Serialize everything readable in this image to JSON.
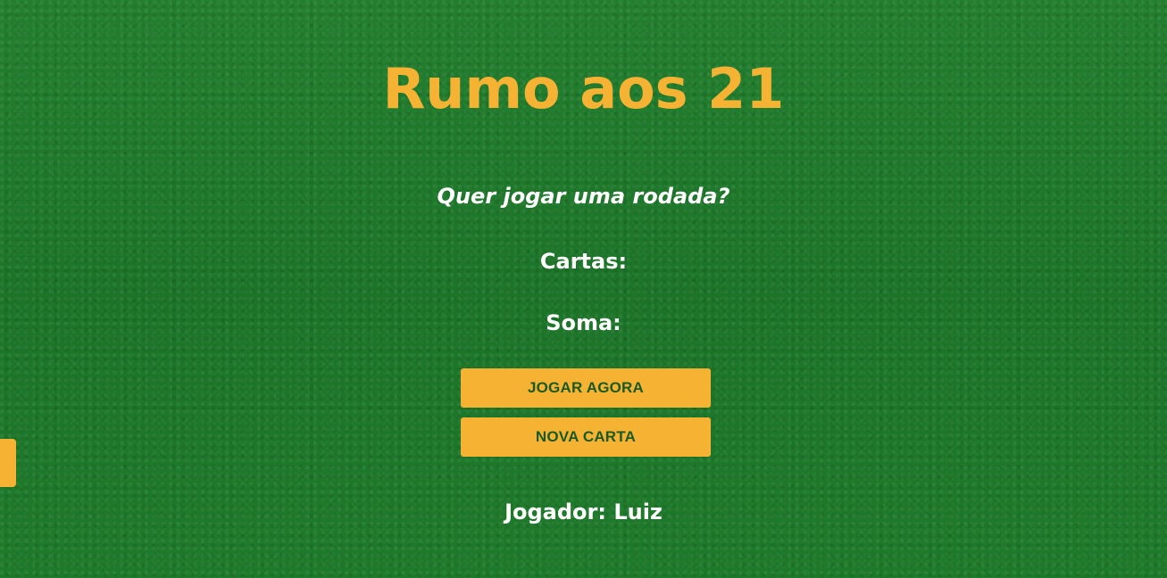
{
  "game": {
    "title": "Rumo aos 21",
    "question": "Quer jogar uma rodada?",
    "cards_label": "Cartas:",
    "sum_label": "Soma:",
    "player_label": "Jogador: Luiz"
  },
  "buttons": {
    "start_label": "JOGAR AGORA",
    "new_card_label": "NOVA CARTA"
  },
  "colors": {
    "accent": "#f6b333",
    "background": "#1f7a2c",
    "button_text": "#1a5a22",
    "text": "#ffffff"
  }
}
